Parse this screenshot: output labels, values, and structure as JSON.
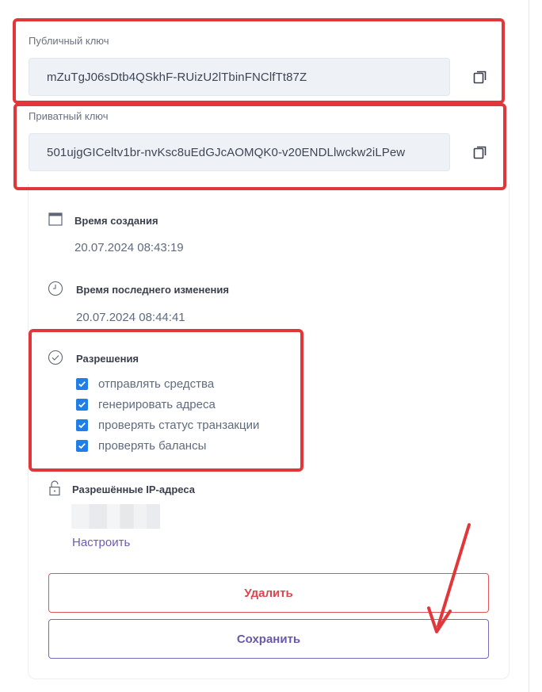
{
  "public_key": {
    "label": "Публичный ключ",
    "value": "mZuTgJ06sDtb4QSkhF-RUizU2lTbinFNClfTt87Z"
  },
  "private_key": {
    "label": "Приватный ключ",
    "value": "501ujgGICeltv1br-nvKsc8uEdGJcAOMQK0-v20ENDLlwckw2iLPew"
  },
  "created": {
    "title": "Время создания",
    "value": "20.07.2024 08:43:19"
  },
  "modified": {
    "title": "Время последнего изменения",
    "value": "20.07.2024 08:44:41"
  },
  "permissions": {
    "title": "Разрешения",
    "items": [
      {
        "label": "отправлять средства",
        "checked": true
      },
      {
        "label": "генерировать адреса",
        "checked": true
      },
      {
        "label": "проверять статус транзакции",
        "checked": true
      },
      {
        "label": "проверять балансы",
        "checked": true
      }
    ]
  },
  "allowed_ips": {
    "title": "Разрешённые IP-адреса",
    "configure_link": "Настроить"
  },
  "buttons": {
    "delete": "Удалить",
    "save": "Сохранить"
  },
  "colors": {
    "annotation_red": "#e2373a",
    "checkbox_blue": "#1f7ee8",
    "link_purple": "#6e59b5",
    "delete_red": "#e0444f"
  }
}
